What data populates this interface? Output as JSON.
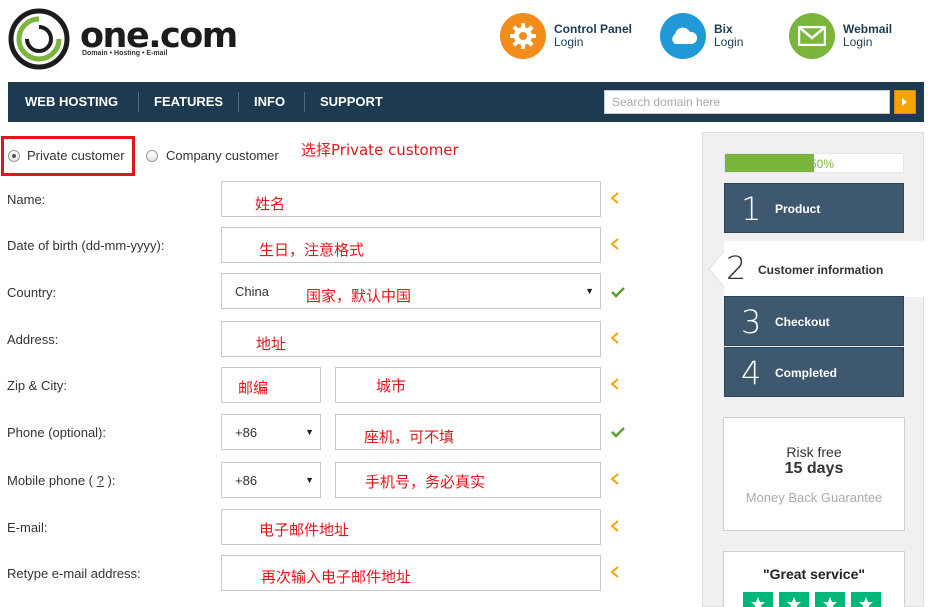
{
  "brand": {
    "name": "one.com",
    "tagline": "Domain • Hosting • E-mail"
  },
  "header_links": [
    {
      "title": "Control Panel",
      "sub": "Login",
      "icon": "gear-icon",
      "color": "#f28c1b"
    },
    {
      "title": "Bix",
      "sub": "Login",
      "icon": "cloud-icon",
      "color": "#1f9ad6"
    },
    {
      "title": "Webmail",
      "sub": "Login",
      "icon": "envelope-icon",
      "color": "#7ab53c"
    }
  ],
  "nav": {
    "items": [
      "WEB HOSTING",
      "FEATURES",
      "INFO",
      "SUPPORT"
    ],
    "search_placeholder": "Search domain here",
    "search_button": "chevron-right-icon"
  },
  "customer_type": {
    "options": [
      "Private customer",
      "Company customer"
    ],
    "selected": "Private customer",
    "annotation": "选择Private customer"
  },
  "form": {
    "name": {
      "label": "Name:",
      "annotation": "姓名"
    },
    "dob": {
      "label": "Date of birth (dd-mm-yyyy):",
      "annotation": "生日，注意格式"
    },
    "country": {
      "label": "Country:",
      "value": "China",
      "annotation": "国家，默认中国"
    },
    "address": {
      "label": "Address:",
      "annotation": "地址"
    },
    "zip_city": {
      "label": "Zip & City:",
      "zip_annotation": "邮编",
      "city_annotation": "城市"
    },
    "phone": {
      "label": "Phone (optional):",
      "code": "+86",
      "annotation": "座机，可不填"
    },
    "mobile": {
      "label_prefix": "Mobile phone (",
      "help": "?",
      "label_suffix": "):",
      "code": "+86",
      "annotation": "手机号，务必真实"
    },
    "email": {
      "label": "E-mail:",
      "annotation": "电子邮件地址"
    },
    "email_retype": {
      "label": "Retype e-mail address:",
      "annotation": "再次输入电子邮件地址"
    }
  },
  "sidebar": {
    "progress": 0.5,
    "progress_label": "50%",
    "steps": [
      {
        "num": "1",
        "label": "Product"
      },
      {
        "num": "2",
        "label": "Customer information"
      },
      {
        "num": "3",
        "label": "Checkout"
      },
      {
        "num": "4",
        "label": "Completed"
      }
    ],
    "guarantee": {
      "line1": "Risk free",
      "line2": "15 days",
      "line3": "Money Back Guarantee"
    },
    "review_title": "\"Great service\""
  },
  "colors": {
    "nav_bg": "#1d3a50",
    "accent": "#f5a400",
    "annotation": "#e3151c",
    "success": "#7ab53c",
    "step_bg": "#3e5870"
  }
}
